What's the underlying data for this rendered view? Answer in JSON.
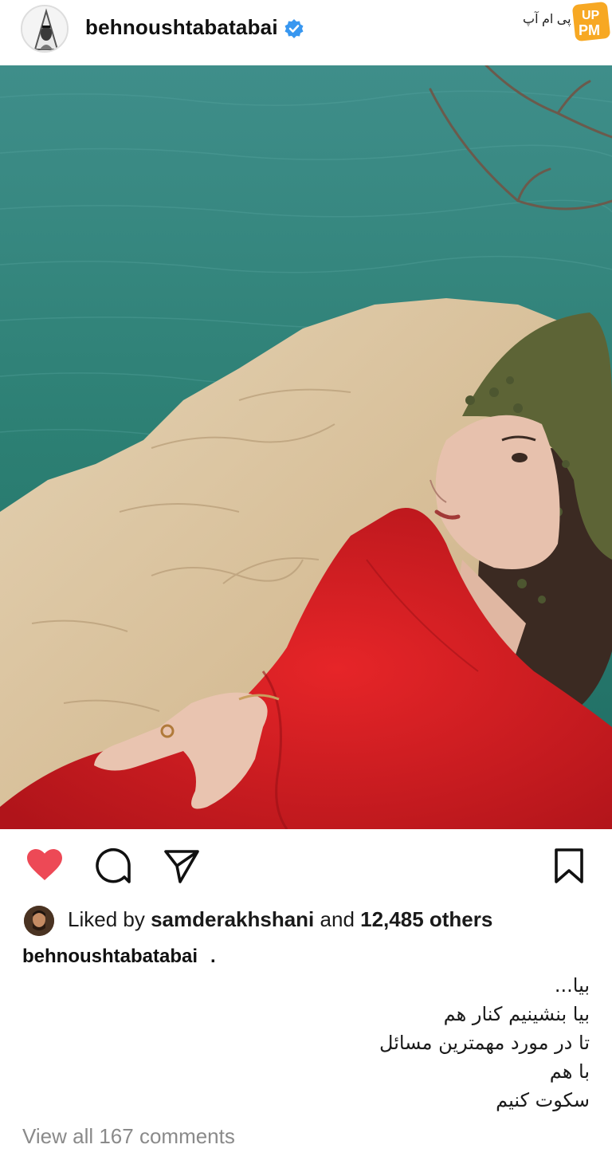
{
  "post": {
    "username": "behnoushtabatabai",
    "verified": true,
    "watermark": {
      "text": "پی ام آپ",
      "badge": "UP PM",
      "badge_color": "#f7a823"
    }
  },
  "photo": {
    "alt": "Woman in red dress with green headscarf sitting on a rocky cliff above the sea",
    "colors": {
      "sea": "#2f8379",
      "rock": "#d9c3a0",
      "dress": "#d81f22",
      "scarf": "#5d6436"
    }
  },
  "actions": {
    "like_icon": "heart-icon",
    "comment_icon": "comment-icon",
    "share_icon": "send-icon",
    "save_icon": "bookmark-icon",
    "liked": true,
    "like_color": "#ed4956"
  },
  "likes": {
    "prefix": "Liked by ",
    "user": "samderakhshani",
    "middle": " and ",
    "count": "12,485 others"
  },
  "caption": {
    "username": "behnoushtabatabai",
    "suffix": ".",
    "lines": [
      "بیا...",
      "بیا بنشینیم کنار هم",
      "تا در مورد مهمترین مسائل",
      "با هم",
      "سکوت کنیم"
    ]
  },
  "comments": {
    "view_all": "View all 167 comments"
  }
}
